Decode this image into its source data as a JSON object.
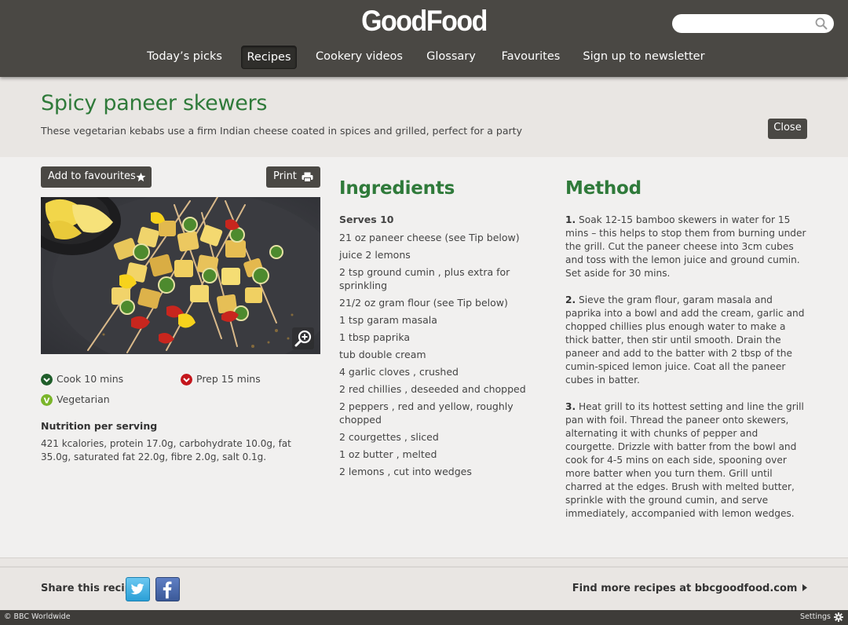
{
  "header": {
    "logo": "GoodFood",
    "search": {
      "placeholder": "",
      "value": ""
    },
    "nav": [
      {
        "label": "Today’s picks",
        "active": false
      },
      {
        "label": "Recipes",
        "active": true
      },
      {
        "label": "Cookery videos",
        "active": false
      },
      {
        "label": "Glossary",
        "active": false
      },
      {
        "label": "Favourites",
        "active": false
      },
      {
        "label": "Sign up to newsletter",
        "active": false
      }
    ]
  },
  "recipe": {
    "title": "Spicy paneer skewers",
    "description": "These vegetarian kebabs use a firm Indian cheese coated in spices and grilled, perfect for a party",
    "close_label": "Close",
    "add_favourites_label": "Add to favourites",
    "print_label": "Print",
    "cook_time": "Cook 10 mins",
    "prep_time": "Prep 15 mins",
    "diet": "Vegetarian",
    "diet_badge": "V",
    "nutrition_heading": "Nutrition per serving",
    "nutrition_text": "421 kcalories, protein 17.0g, carbohydrate 10.0g, fat 35.0g, saturated fat 22.0g, fibre 2.0g, salt 0.1g."
  },
  "ingredients": {
    "heading": "Ingredients",
    "serves": "Serves 10",
    "items": [
      "21 oz paneer cheese (see Tip below)",
      "juice 2 lemons",
      "2 tsp ground cumin , plus extra for sprinkling",
      "21/2 oz gram flour (see Tip below)",
      "1 tsp garam masala",
      "1 tbsp paprika",
      "tub double cream",
      "4 garlic cloves , crushed",
      "2 red chillies , deseeded and chopped",
      "2 peppers , red and yellow, roughly chopped",
      "2 courgettes , sliced",
      "1 oz butter , melted",
      "2 lemons , cut into wedges"
    ]
  },
  "method": {
    "heading": "Method",
    "steps": [
      {
        "num": "1.",
        "text": " Soak 12-15 bamboo skewers in water for 15 mins – this helps to stop them from burning under the grill. Cut the paneer cheese into 3cm cubes and toss with the lemon juice and ground cumin. Set aside for 30 mins."
      },
      {
        "num": "2.",
        "text": " Sieve the gram flour, garam masala and paprika into a bowl and add the cream, garlic and chopped chillies plus enough water to make a thick batter, then stir until smooth. Drain the paneer and add to the batter with 2 tbsp of the cumin-spiced lemon juice. Coat all the paneer cubes in batter."
      },
      {
        "num": "3.",
        "text": " Heat grill to its hottest setting and line the grill pan with foil. Thread the paneer onto skewers, alternating it with chunks of pepper and courgette. Drizzle with batter from the bowl and cook for 4-5 mins on each side, spooning over more batter when you turn them. Grill until charred at the edges. Brush with melted butter, sprinkle with the ground cumin, and serve immediately, accompanied with lemon wedges."
      }
    ]
  },
  "footer": {
    "share_label": "Share this recipe",
    "find_more": "Find more recipes at bbcgoodfood.com",
    "copyright": "© BBC Worldwide",
    "settings": "Settings"
  },
  "colors": {
    "header_bg": "#4a4844",
    "accent_green": "#2f7a3a",
    "cook_icon": "#1f5d2a",
    "prep_icon": "#c4161c",
    "veg_icon": "#7ab52a"
  },
  "icons": [
    "search-icon",
    "star-icon",
    "printer-icon",
    "zoom-in-icon",
    "clock-icon",
    "vegetarian-icon",
    "twitter-icon",
    "facebook-icon",
    "chevron-right-icon",
    "gear-icon"
  ]
}
